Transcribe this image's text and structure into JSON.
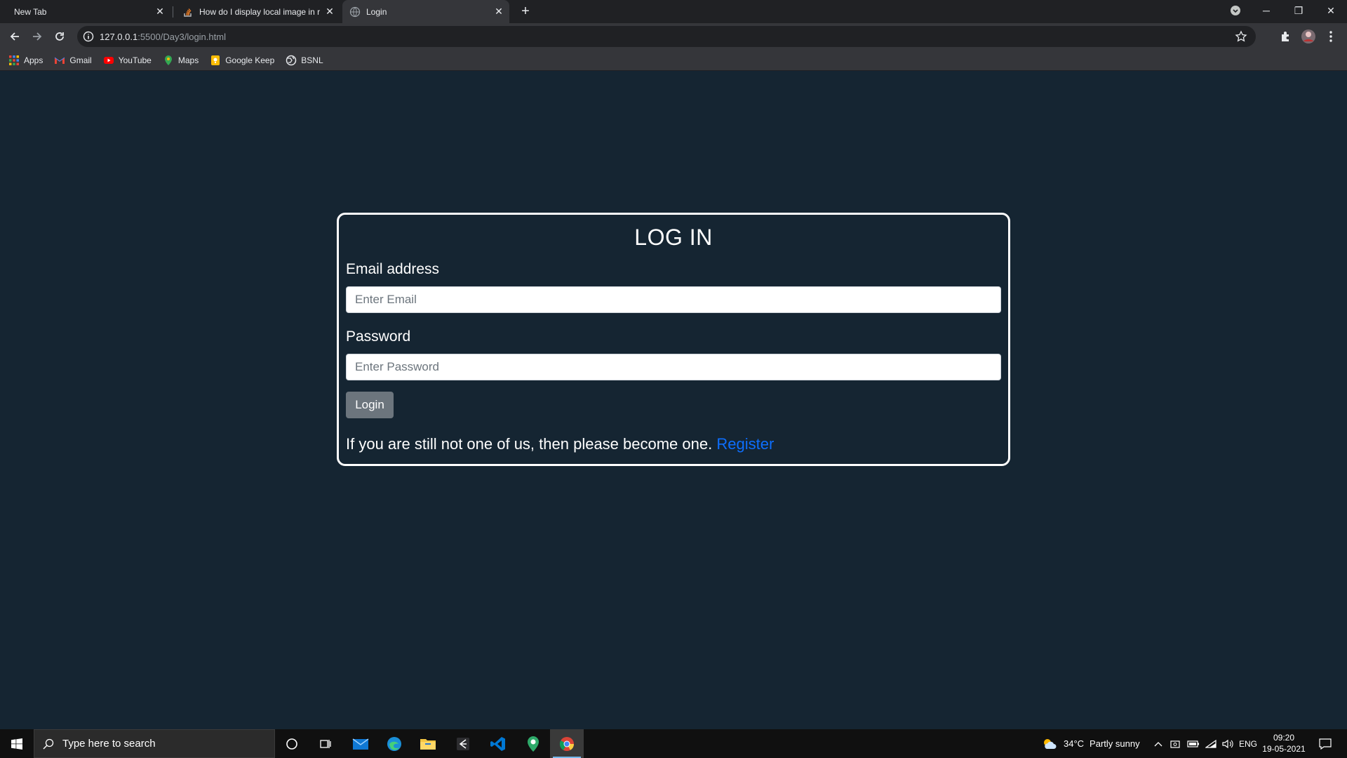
{
  "browser": {
    "tabs": [
      {
        "title": "New Tab",
        "active": false
      },
      {
        "title": "How do I display local image in r",
        "active": false
      },
      {
        "title": "Login",
        "active": true
      }
    ],
    "url_host": "127.0.0.1",
    "url_path": ":5500/Day3/login.html",
    "bookmarks": [
      "Apps",
      "Gmail",
      "YouTube",
      "Maps",
      "Google Keep",
      "BSNL"
    ]
  },
  "login": {
    "title": "LOG IN",
    "email_label": "Email address",
    "email_placeholder": "Enter Email",
    "email_value": "",
    "password_label": "Password",
    "password_placeholder": "Enter Password",
    "password_value": "",
    "button_label": "Login",
    "register_prompt": "If you are still not one of us, then please become one.",
    "register_link": "Register"
  },
  "taskbar": {
    "search_placeholder": "Type here to search",
    "weather_temp": "34°C",
    "weather_text": "Partly sunny",
    "language": "ENG",
    "time": "09:20",
    "date": "19-05-2021"
  },
  "colors": {
    "page_bg": "#152532",
    "link": "#0d6efd",
    "button_bg": "#6c757d"
  }
}
